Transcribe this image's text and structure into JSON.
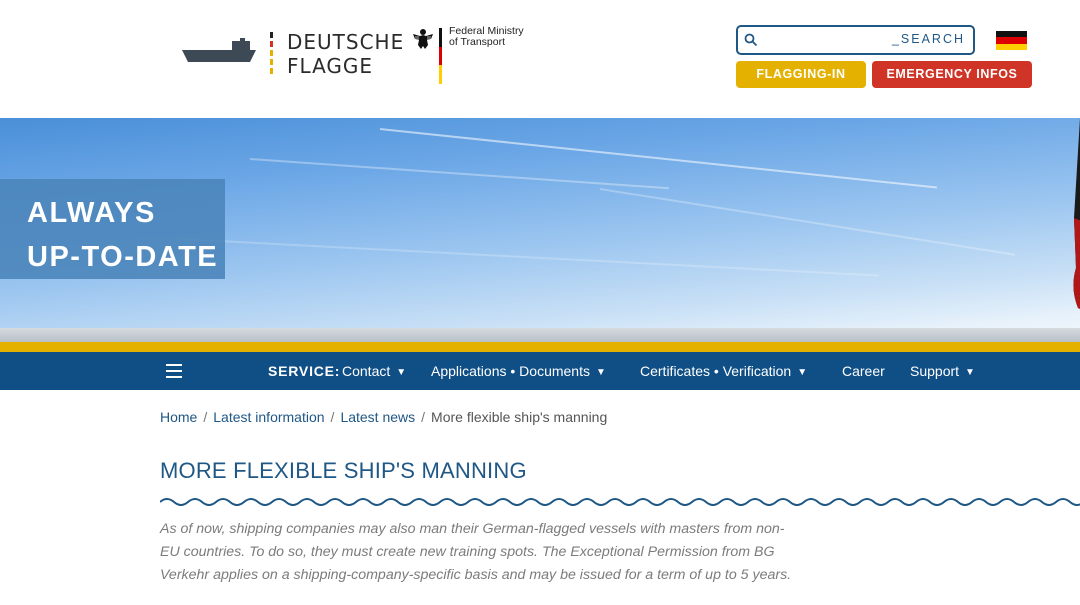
{
  "header": {
    "logo": {
      "line1": "DEUTSCHE",
      "line2": "FLAGGE"
    },
    "ministry": {
      "line1": "Federal Ministry",
      "line2": "of Transport"
    },
    "search": {
      "placeholder": "",
      "label": "_SEARCH"
    },
    "buttons": {
      "flagging_in": "FLAGGING-IN",
      "emergency": "EMERGENCY INFOS"
    }
  },
  "hero": {
    "line1": "ALWAYS",
    "line2": "UP-TO-DATE"
  },
  "nav": {
    "service_label": "SERVICE:",
    "items": [
      {
        "label": "Contact",
        "dropdown": true
      },
      {
        "label": "Applications • Documents",
        "dropdown": true
      },
      {
        "label": "Certificates • Verification",
        "dropdown": true
      },
      {
        "label": "Career",
        "dropdown": false
      },
      {
        "label": "Support",
        "dropdown": true
      }
    ]
  },
  "breadcrumb": {
    "items": [
      "Home",
      "Latest information",
      "Latest news"
    ],
    "current": "More flexible ship's manning"
  },
  "article": {
    "title": "MORE FLEXIBLE SHIP'S MANNING",
    "intro": "As of now, shipping companies may also man their German-flagged vessels with masters from non-EU countries. To do so, they must create new training spots. The Exceptional Permission from BG Verkehr applies on a shipping-company-specific basis and may be issued for a term of up to 5 years."
  },
  "colors": {
    "primary": "#1f5785",
    "nav_bg": "#0f4f86",
    "gold": "#e4b100",
    "red": "#cf3427"
  },
  "icons": [
    "ship-logo-icon",
    "federal-eagle-icon",
    "search-icon",
    "german-flag-icon",
    "hamburger-menu-icon",
    "caret-down-icon"
  ]
}
